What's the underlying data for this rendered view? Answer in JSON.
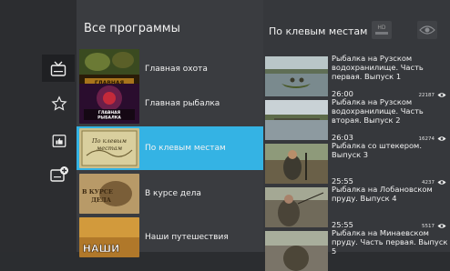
{
  "sidebar": {
    "items": [
      {
        "icon": "tv-icon",
        "selected": true
      },
      {
        "icon": "star-icon",
        "selected": false
      },
      {
        "icon": "thumbs-up-icon",
        "selected": false
      },
      {
        "icon": "add-channel-icon",
        "selected": false
      }
    ]
  },
  "programs": {
    "title": "Все программы",
    "items": [
      {
        "label": "Главная охота",
        "thumb_text": "ГЛАВНАЯ"
      },
      {
        "label": "Главная рыбалка",
        "thumb_text": "ГЛАВНАЯ РЫБАЛКА"
      },
      {
        "label": "По клевым местам",
        "thumb_text": "ПО КЛЕВЫМ МЕСТАМ"
      },
      {
        "label": "В курсе дела",
        "thumb_text": "В КУРСЕ ДЕЛА"
      },
      {
        "label": "Наши путешествия",
        "thumb_text": "НАШИ"
      }
    ],
    "selected_index": 2
  },
  "episodes": {
    "title": "По клевым местам",
    "items": [
      {
        "title": "Рыбалка на Рузском водохранилище. Часть первая. Выпуск 1",
        "duration": "26:00",
        "views": "22187"
      },
      {
        "title": "Рыбалка на Рузском водохранилище. Часть вторая. Выпуск 2",
        "duration": "26:03",
        "views": "16274"
      },
      {
        "title": "Рыбалка со штекером. Выпуск 3",
        "duration": "25:55",
        "views": "4237"
      },
      {
        "title": "Рыбалка на Лобановском пруду. Выпуск 4",
        "duration": "25:55",
        "views": "5517"
      },
      {
        "title": "Рыбалка на Минаевском пруду. Часть первая. Выпуск 5",
        "duration": "",
        "views": ""
      }
    ]
  },
  "colors": {
    "accent": "#34b3e4",
    "sidebar_bg": "#2c2d30",
    "programs_bg": "#3a3c40",
    "episodes_bg": "#36383c"
  }
}
